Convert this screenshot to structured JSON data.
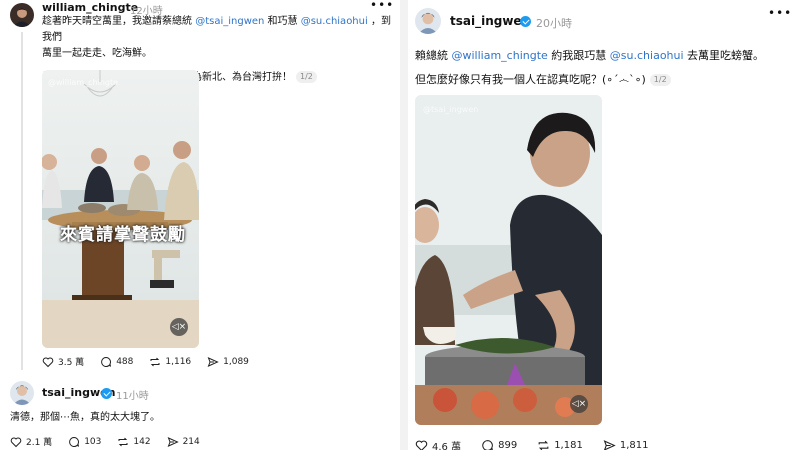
{
  "left_post": {
    "username": "william_chingte",
    "time": "12小時",
    "line1_a": "趁著昨天晴空萬里，我邀請蔡總統 ",
    "mention1": "@tsai_ingwen",
    "line1_b": " 和巧慧 ",
    "mention2": "@su.chiaohui",
    "line1_c": " ，到我們",
    "line2": "萬里一起走走、吃海鮮。",
    "line3": "希望大家吃飽更有力氣，一起繼續為新北、為台灣打拚！",
    "pager": "1/2",
    "video_caption": "來賓請掌聲鼓勵",
    "watermark": "@william_chingte",
    "stats": {
      "likes": "3.5 萬",
      "comments": "488",
      "reposts": "1,116",
      "shares": "1,089"
    }
  },
  "reply_post": {
    "username": "tsai_ingwen",
    "time": "11小時",
    "text": "清德，那個⋯魚，真的太大塊了。",
    "stats": {
      "likes": "2.1 萬",
      "comments": "103",
      "reposts": "142",
      "shares": "214"
    }
  },
  "right_post": {
    "username": "tsai_ingwen",
    "time": "20小時",
    "line1_a": "賴總統 ",
    "mention1": "@william_chingte",
    "line1_b": " 約我跟巧慧 ",
    "mention2": "@su.chiaohui",
    "line1_c": " 去萬里吃螃蟹。",
    "line2": "但怎麼好像只有我一個人在認真吃呢？(∘ˊ෴ˋ∘)",
    "pager": "1/2",
    "watermark": "@tsai_ingwen",
    "stats": {
      "likes": "4.6 萬",
      "comments": "899",
      "reposts": "1,181",
      "shares": "1,811"
    }
  },
  "more_icon": "more-horizontal-icon",
  "colors": {
    "mention": "#2f74c9",
    "verified": "#1d9bf0"
  }
}
